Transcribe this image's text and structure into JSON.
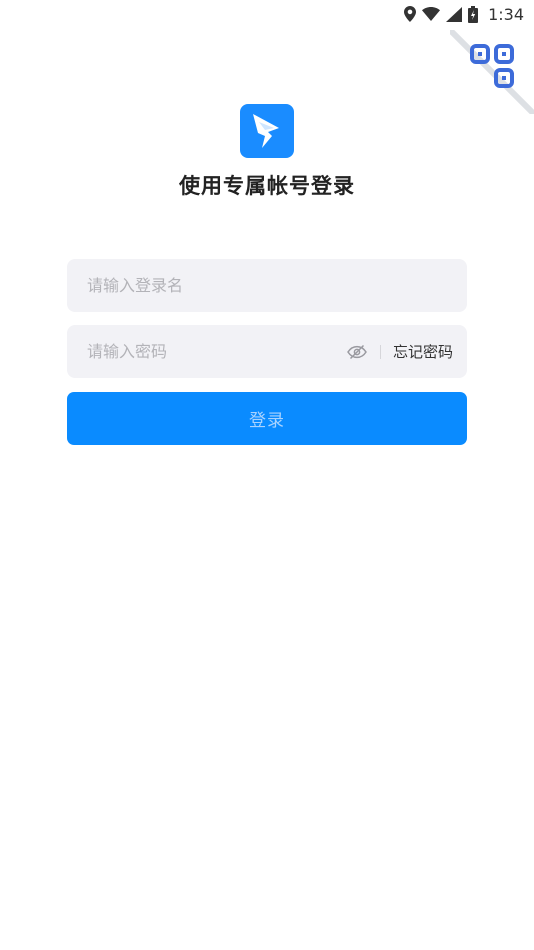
{
  "status_bar": {
    "time": "1:34",
    "icons": [
      "location-icon",
      "wifi-icon",
      "signal-icon",
      "battery-icon"
    ]
  },
  "qr_corner": {
    "icon": "qr-code-icon",
    "color": "#3d6bd9"
  },
  "logo": {
    "icon": "app-logo-icon",
    "color": "#1a8cff"
  },
  "title": "使用专属帐号登录",
  "form": {
    "username": {
      "value": "",
      "placeholder": "请输入登录名"
    },
    "password": {
      "value": "",
      "placeholder": "请输入密码",
      "visibility_icon": "eye-off-icon",
      "forgot_label": "忘记密码"
    },
    "login_label": "登录"
  },
  "colors": {
    "primary": "#0a8bff",
    "field_background": "#f2f2f6",
    "login_text_disabled": "#a9d3ff"
  }
}
